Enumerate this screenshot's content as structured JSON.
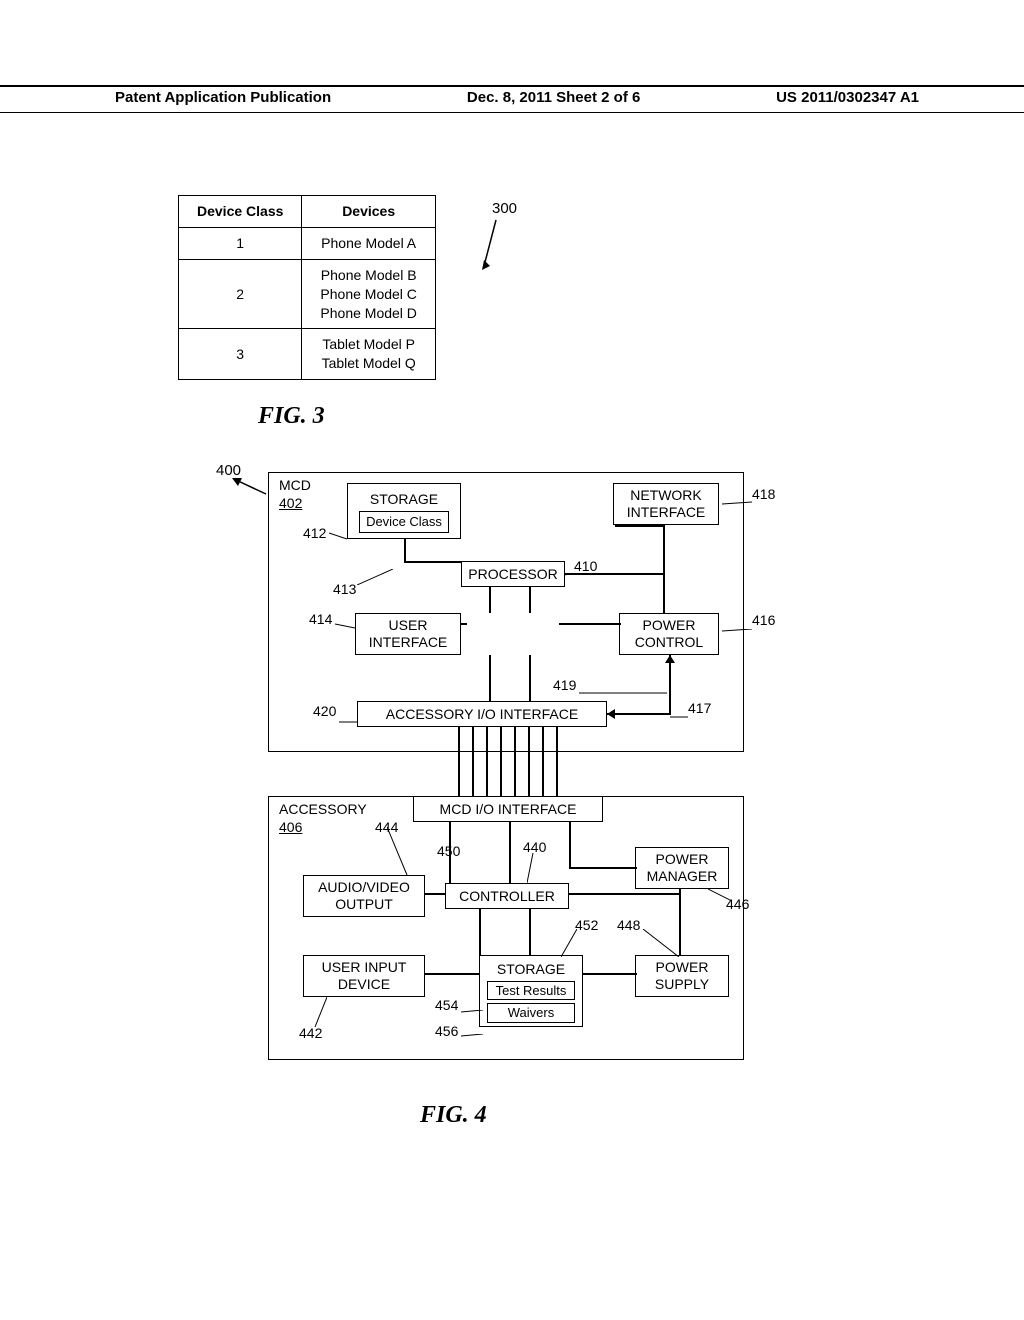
{
  "header": {
    "left": "Patent Application Publication",
    "center": "Dec. 8, 2011  Sheet 2 of 6",
    "right": "US 2011/0302347 A1"
  },
  "fig3": {
    "caption": "FIG. 3",
    "ref": "300",
    "headers": {
      "c1": "Device Class",
      "c2": "Devices"
    },
    "rows": [
      {
        "class": "1",
        "devices": "Phone Model A"
      },
      {
        "class": "2",
        "devices": "Phone Model B\nPhone Model C\nPhone Model D"
      },
      {
        "class": "3",
        "devices": "Tablet Model P\nTablet Model Q"
      }
    ]
  },
  "fig4": {
    "caption": "FIG. 4",
    "ref400": "400",
    "mcd": {
      "label": "MCD",
      "refnum": "402",
      "storage": "STORAGE",
      "device_class": "Device Class",
      "network": "NETWORK\nINTERFACE",
      "processor": "PROCESSOR",
      "user_if": "USER\nINTERFACE",
      "power_ctrl": "POWER\nCONTROL",
      "acc_io": "ACCESSORY I/O INTERFACE",
      "refs": {
        "r412": "412",
        "r413": "413",
        "r414": "414",
        "r418": "418",
        "r410": "410",
        "r416": "416",
        "r419": "419",
        "r417": "417",
        "r420": "420"
      }
    },
    "acc": {
      "label": "ACCESSORY",
      "refnum": "406",
      "mcd_io": "MCD I/O INTERFACE",
      "av_out": "AUDIO/VIDEO\nOUTPUT",
      "controller": "CONTROLLER",
      "power_mgr": "POWER\nMANAGER",
      "user_input": "USER INPUT\nDEVICE",
      "storage": "STORAGE",
      "test_results": "Test Results",
      "waivers": "Waivers",
      "power_supply": "POWER\nSUPPLY",
      "refs": {
        "r444": "444",
        "r450": "450",
        "r440": "440",
        "r446": "446",
        "r448": "448",
        "r452": "452",
        "r442": "442",
        "r454": "454",
        "r456": "456"
      }
    }
  }
}
